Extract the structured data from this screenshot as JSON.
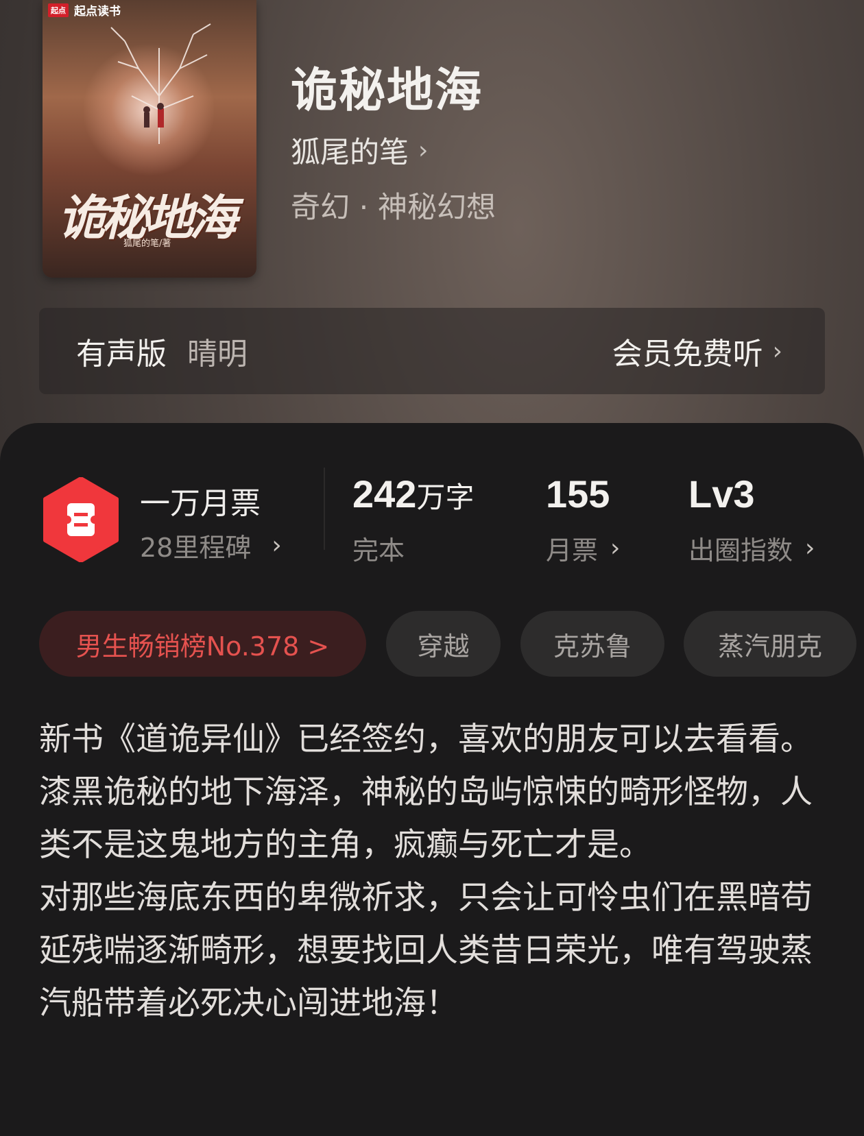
{
  "book": {
    "title": "诡秘地海",
    "author": "狐尾的笔",
    "genre": "奇幻 · 神秘幻想",
    "cover": {
      "brand_badge": "起点",
      "brand": "起点读书",
      "title": "诡秘地海",
      "author": "狐尾的笔/著"
    }
  },
  "audio": {
    "label": "有声版",
    "narrator": "晴明",
    "action": "会员免费听"
  },
  "stats": {
    "milestone_title": "一万月票",
    "milestone_sub": "28里程碑",
    "words_num": "242",
    "words_unit": "万字",
    "words_label": "完本",
    "tickets_num": "155",
    "tickets_label": "月票",
    "level_num": "Lv3",
    "level_label": "出圈指数"
  },
  "tags": {
    "rank": "男生畅销榜No.378 >",
    "t1": "穿越",
    "t2": "克苏鲁",
    "t3": "蒸汽朋克"
  },
  "description": {
    "p1": "新书《道诡异仙》已经签约，喜欢的朋友可以去看看。",
    "p2": "漆黑诡秘的地下海泽，神秘的岛屿惊悚的畸形怪物，人类不是这鬼地方的主角，疯癫与死亡才是。",
    "p3": "对那些海底东西的卑微祈求，只会让可怜虫们在黑暗苟延残喘逐渐畸形，想要找回人类昔日荣光，唯有驾驶蒸汽船带着必死决心闯进地海！"
  },
  "colors": {
    "accent_red": "#e5524f",
    "icon_red": "#f0373c",
    "panel_bg": "#1b1a1b"
  },
  "icons": {
    "chevron": "chevron-right-icon",
    "milestone": "ticket-icon"
  }
}
